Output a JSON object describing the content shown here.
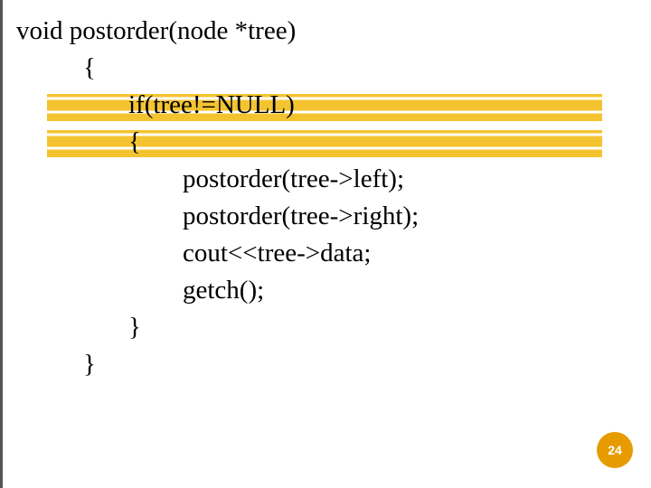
{
  "code": {
    "line1": "void postorder(node *tree)",
    "line2": "{",
    "line3": "if(tree!=NULL)",
    "line4": "{",
    "line5": "postorder(tree->left);",
    "line6": "postorder(tree->right);",
    "line7": "cout<<tree->data;",
    "line8": "getch();",
    "line9": "}",
    "line10": "}"
  },
  "page_number": "24"
}
